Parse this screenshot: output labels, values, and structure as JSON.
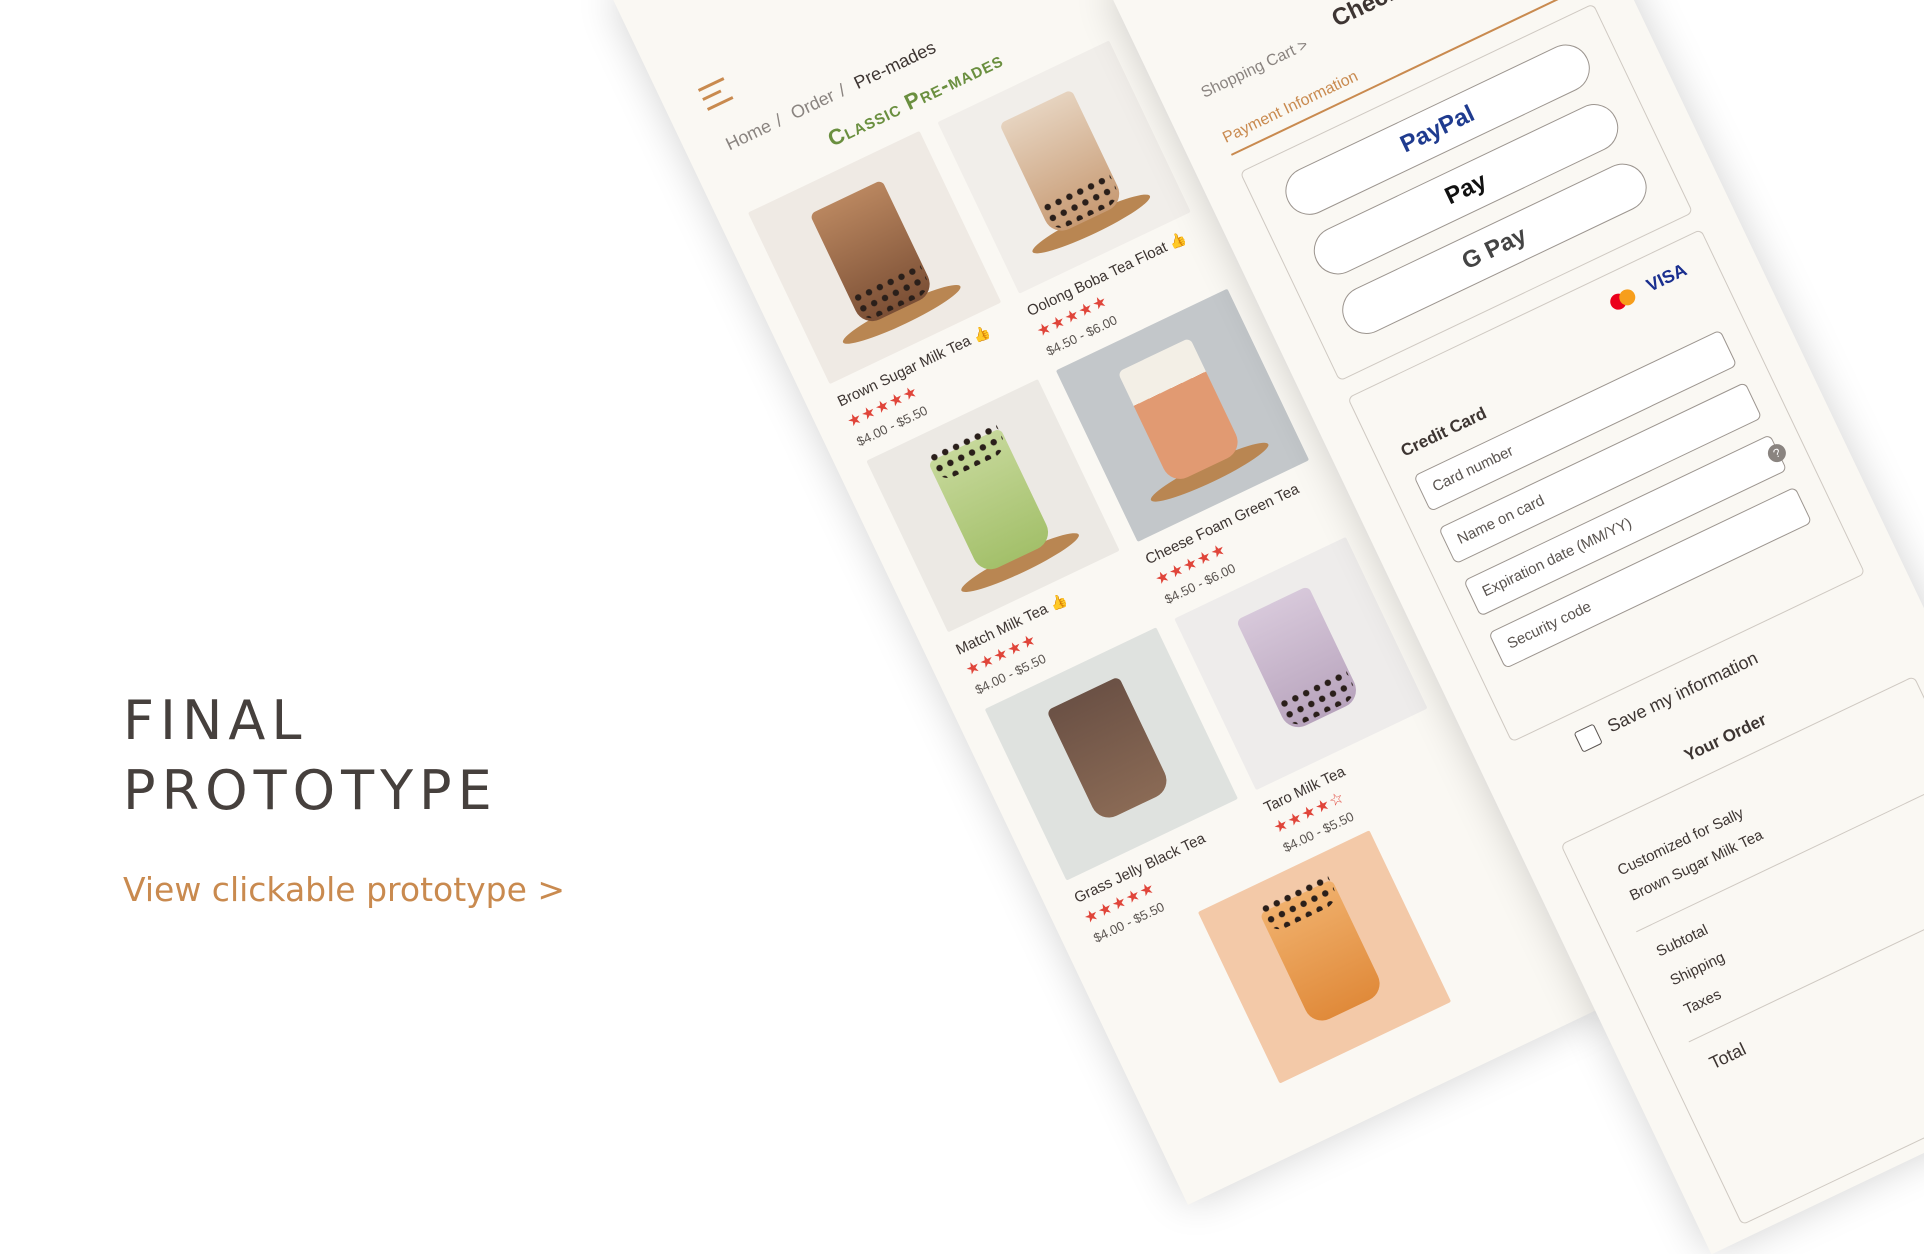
{
  "hero": {
    "title_line1": "FINAL",
    "title_line2": "PROTOTYPE",
    "link_text": "View clickable prototype >"
  },
  "catalog": {
    "breadcrumb": [
      "Home",
      "Order",
      "Pre-mades"
    ],
    "section_title": "Classic Pre-mades",
    "products": [
      {
        "name": "Brown Sugar Milk Tea",
        "stars": "★★★★★",
        "price": "$4.00 - $5.50",
        "liked": true,
        "colors": {
          "bg": "#efeae4",
          "tea": "#a47552"
        }
      },
      {
        "name": "Oolong Boba Tea Float",
        "stars": "★★★★★",
        "price": "$4.50 - $6.00",
        "liked": true,
        "colors": {
          "bg": "#f1eeea",
          "tea": "#c79a73"
        }
      },
      {
        "name": "Match Milk Tea",
        "stars": "★★★★★",
        "price": "$4.00 - $5.50",
        "liked": true,
        "colors": {
          "bg": "#ece9e4",
          "tea": "#a3c06a"
        }
      },
      {
        "name": "Cheese Foam Green Tea",
        "stars": "★★★★★",
        "price": "$4.50 - $6.00",
        "liked": false,
        "colors": {
          "bg": "#c3c7ca",
          "tea": "#e19a72"
        }
      },
      {
        "name": "Grass Jelly Black Tea",
        "stars": "★★★★★",
        "price": "$4.00 - $5.50",
        "liked": false,
        "colors": {
          "bg": "#dfe2df",
          "tea": "#8a6a55"
        }
      },
      {
        "name": "Taro Milk Tea",
        "stars": "★★★★☆",
        "price": "$4.00 - $5.50",
        "liked": false,
        "colors": {
          "bg": "#eeeceb",
          "tea": "#b8a4bd"
        }
      },
      {
        "name": "",
        "stars": "",
        "price": "",
        "liked": false,
        "colors": {
          "bg": "#f3c9a8",
          "tea": "#e08a3a"
        }
      }
    ]
  },
  "checkout": {
    "breadcrumb": "Shopping Cart >",
    "title": "Checkout",
    "section": "Payment Information",
    "pay_buttons": [
      "PayPal",
      " Pay",
      "G Pay"
    ],
    "card_brand": "VISA",
    "credit_card_label": "Credit Card",
    "fields": [
      "Card number",
      "Name on card",
      "Expiration date (MM/YY)",
      "Security code"
    ],
    "help_icon": "?",
    "save_label": "Save my information",
    "order_title": "Your Order",
    "order_lines": [
      "Customized for Sally",
      "Brown Sugar Milk Tea"
    ],
    "summary": [
      "Subtotal",
      "Shipping",
      "Taxes"
    ],
    "total_label": "Total"
  }
}
